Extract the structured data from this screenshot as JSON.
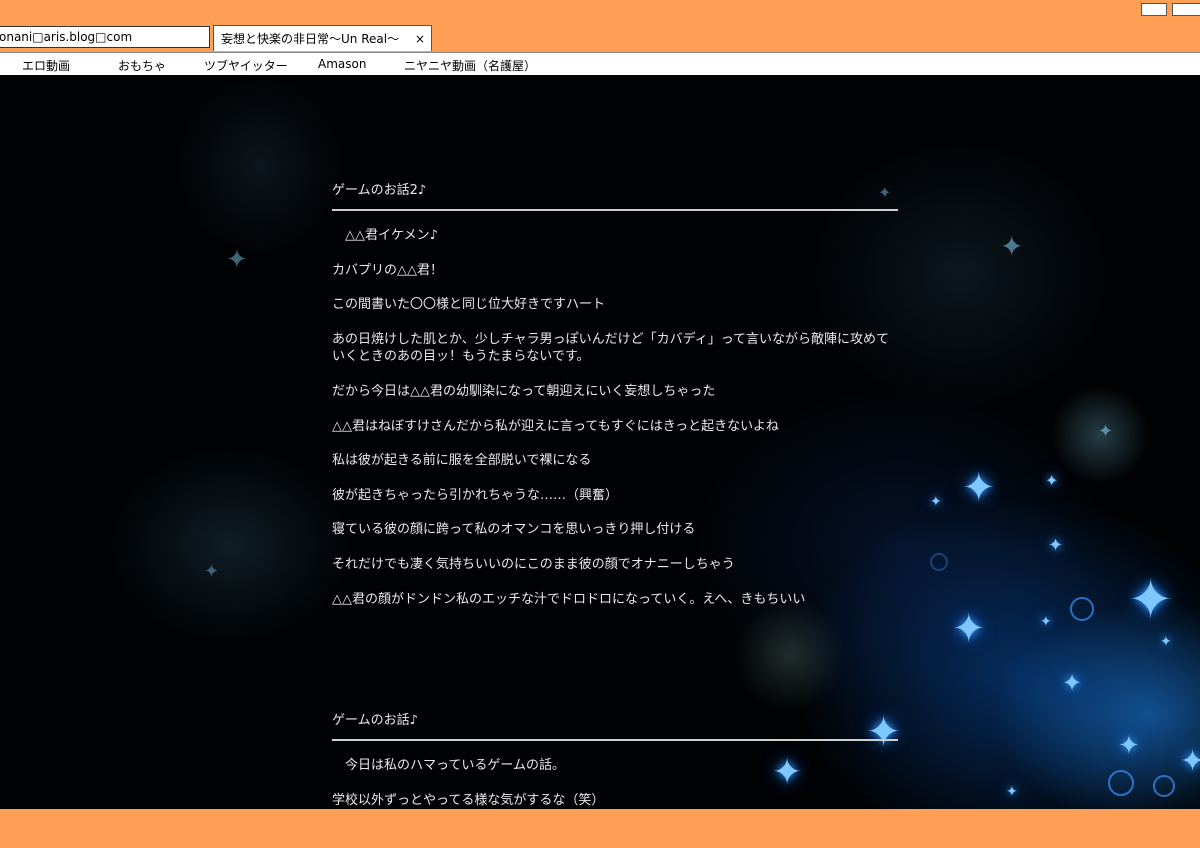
{
  "browser": {
    "address": "onani□aris.blog□com",
    "tab_title": "妄想と快楽の非日常～Un Real～",
    "tab_close": "×"
  },
  "bookmarks": [
    "エロ動画",
    "おもちゃ",
    "ツブヤイッター",
    "Amason",
    "ニヤニヤ動画（名護屋）"
  ],
  "posts": [
    {
      "title": "ゲームのお話2♪",
      "paragraphs": [
        "　△△君イケメン♪",
        "カバプリの△△君！",
        "この間書いた〇〇様と同じ位大好きですハート",
        "あの日焼けした肌とか、少しチャラ男っぽいんだけど「カバディ」って言いながら敵陣に攻めていくときのあの目ッ！もうたまらないです。",
        "だから今日は△△君の幼馴染になって朝迎えにいく妄想しちゃった",
        "△△君はねぼすけさんだから私が迎えに言ってもすぐにはきっと起きないよね",
        "私は彼が起きる前に服を全部脱いで裸になる",
        "彼が起きちゃったら引かれちゃうな……（興奮）",
        "寝ている彼の顔に跨って私のオマンコを思いっきり押し付ける",
        "それだけでも凄く気持ちいいのにこのまま彼の顔でオナニーしちゃう",
        "△△君の顔がドンドン私のエッチな汁でドロドロになっていく。えへ、きもちいい"
      ]
    },
    {
      "title": "ゲームのお話♪",
      "paragraphs": [
        "　今日は私のハマっているゲームの話。",
        "学校以外ずっとやってる様な気がするな（笑）"
      ]
    }
  ]
}
